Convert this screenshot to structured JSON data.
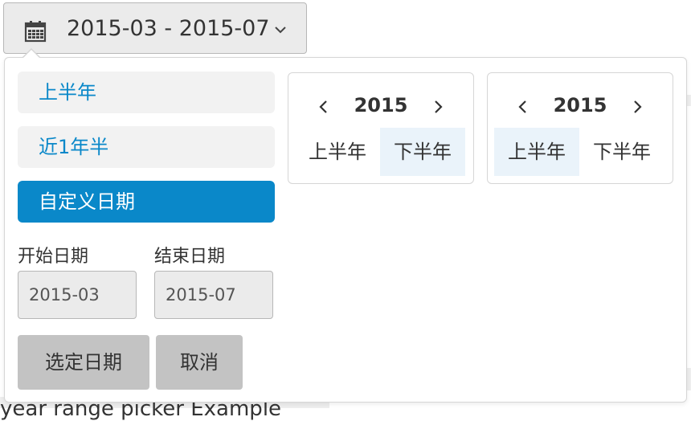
{
  "trigger": {
    "label": "2015-03 - 2015-07",
    "icon": "calendar-icon"
  },
  "background": {
    "caption": "year range picker Example"
  },
  "ranges": [
    {
      "label": "上半年",
      "active": false
    },
    {
      "label": "近1年半",
      "active": false
    },
    {
      "label": "自定义日期",
      "active": true
    }
  ],
  "start": {
    "label": "开始日期",
    "value": "2015-03"
  },
  "end": {
    "label": "结束日期",
    "value": "2015-07"
  },
  "actions": {
    "apply_label": "选定日期",
    "cancel_label": "取消"
  },
  "panels": [
    {
      "year": "2015",
      "halves": [
        "上半年",
        "下半年"
      ],
      "selected": 1
    },
    {
      "year": "2015",
      "halves": [
        "上半年",
        "下半年"
      ],
      "selected": 0
    }
  ],
  "colors": {
    "accent": "#0a88c9",
    "selected_bg": "#eaf3fa",
    "button_bg": "#c3c3c3"
  }
}
